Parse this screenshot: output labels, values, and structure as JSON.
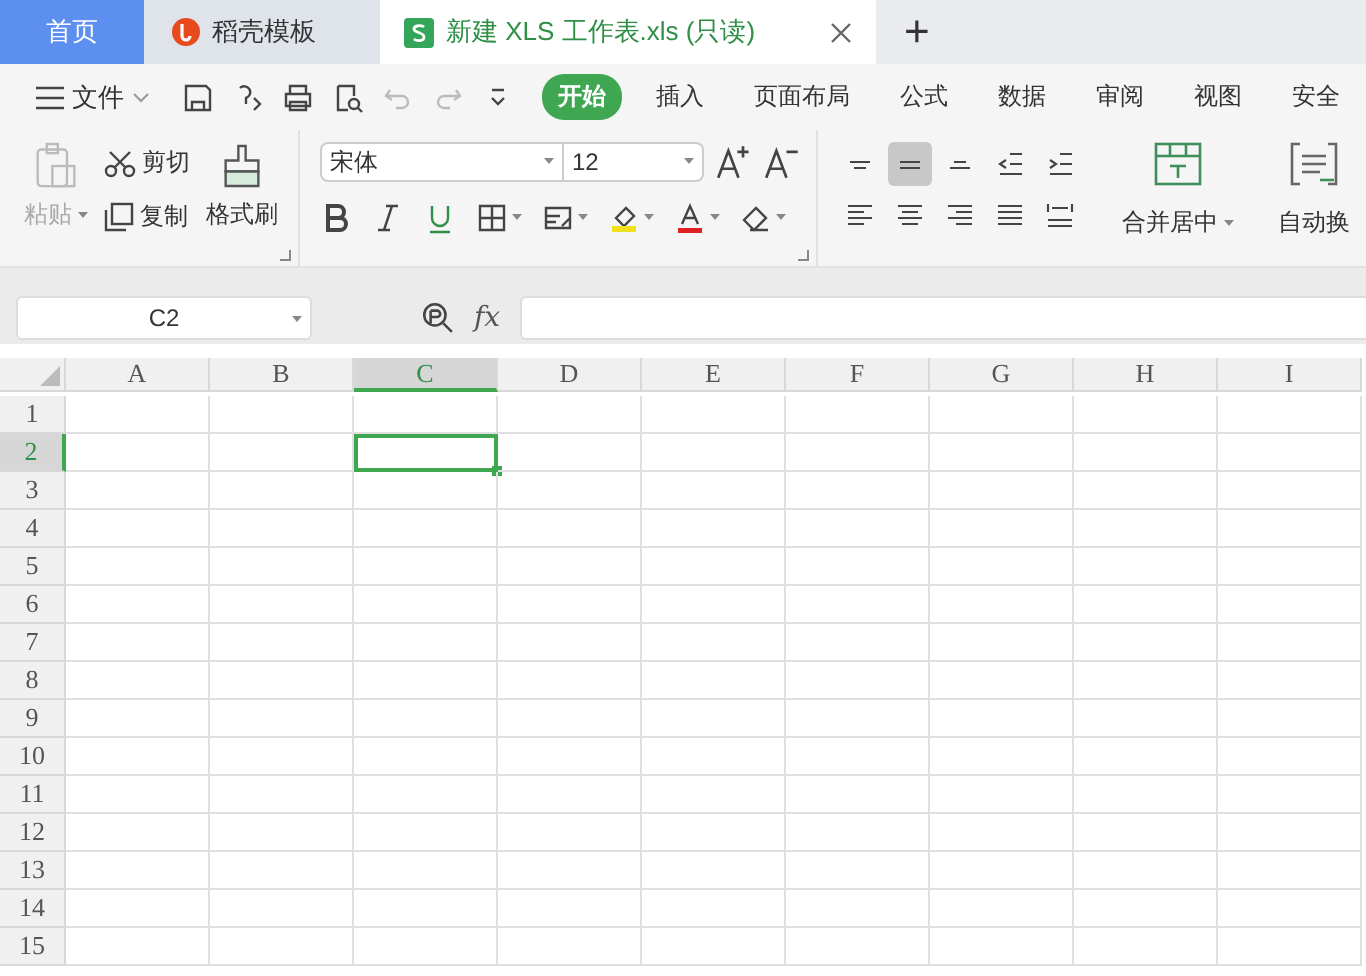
{
  "tabs": [
    {
      "kind": "home",
      "label": "首页",
      "selected": false
    },
    {
      "kind": "template",
      "label": "稻壳模板",
      "selected": false
    },
    {
      "kind": "sheet",
      "label": "新建 XLS 工作表.xls (只读)",
      "selected": true
    }
  ],
  "new_tab": "+",
  "file_menu": "文件",
  "menu": [
    {
      "label": "开始",
      "selected": true
    },
    {
      "label": "插入",
      "selected": false
    },
    {
      "label": "页面布局",
      "selected": false
    },
    {
      "label": "公式",
      "selected": false
    },
    {
      "label": "数据",
      "selected": false
    },
    {
      "label": "审阅",
      "selected": false
    },
    {
      "label": "视图",
      "selected": false
    },
    {
      "label": "安全",
      "selected": false
    }
  ],
  "clipboard": {
    "paste": {
      "label": "粘贴",
      "disabled": true
    },
    "cut": "剪切",
    "copy": "复制",
    "format_painter": "格式刷"
  },
  "font": {
    "name": "宋体",
    "size": "12"
  },
  "align_top": [
    {
      "kind": "top",
      "selected": false
    },
    {
      "kind": "middle",
      "selected": true
    },
    {
      "kind": "bottom",
      "selected": false
    },
    {
      "kind": "outdent",
      "selected": false
    },
    {
      "kind": "indent",
      "selected": false
    }
  ],
  "align_bottom": [
    {
      "kind": "left",
      "selected": false
    },
    {
      "kind": "center",
      "selected": false
    },
    {
      "kind": "right",
      "selected": false
    },
    {
      "kind": "justify",
      "selected": false
    },
    {
      "kind": "distributed",
      "selected": false
    }
  ],
  "merge": "合并居中",
  "wrap": "自动换",
  "name_box": "C2",
  "fx": "fx",
  "columns": [
    {
      "label": "A",
      "selected": false
    },
    {
      "label": "B",
      "selected": false
    },
    {
      "label": "C",
      "selected": true
    },
    {
      "label": "D",
      "selected": false
    },
    {
      "label": "E",
      "selected": false
    },
    {
      "label": "F",
      "selected": false
    },
    {
      "label": "G",
      "selected": false
    },
    {
      "label": "H",
      "selected": false
    },
    {
      "label": "I",
      "selected": false
    }
  ],
  "rows": [
    {
      "label": "1",
      "selected": false
    },
    {
      "label": "2",
      "selected": true
    },
    {
      "label": "3",
      "selected": false
    },
    {
      "label": "4",
      "selected": false
    },
    {
      "label": "5",
      "selected": false
    },
    {
      "label": "6",
      "selected": false
    },
    {
      "label": "7",
      "selected": false
    },
    {
      "label": "8",
      "selected": false
    },
    {
      "label": "9",
      "selected": false
    },
    {
      "label": "10",
      "selected": false
    },
    {
      "label": "11",
      "selected": false
    },
    {
      "label": "12",
      "selected": false
    },
    {
      "label": "13",
      "selected": false
    },
    {
      "label": "14",
      "selected": false
    },
    {
      "label": "15",
      "selected": false
    }
  ]
}
